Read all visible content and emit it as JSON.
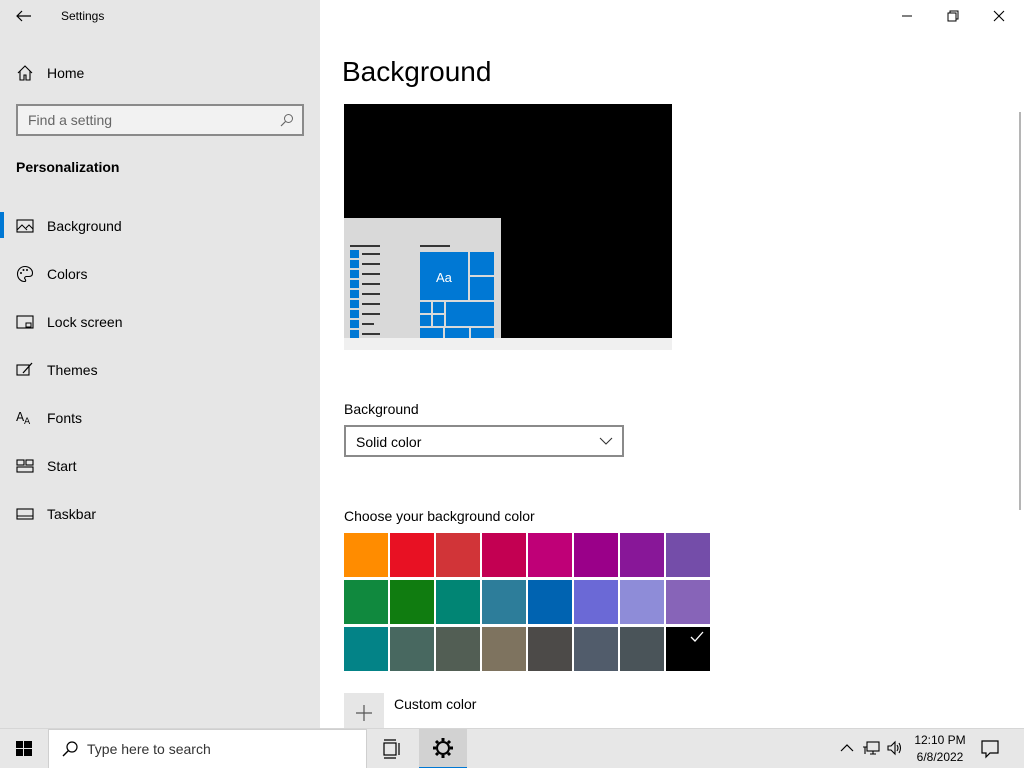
{
  "app": {
    "title": "Settings"
  },
  "sidebar": {
    "home_label": "Home",
    "search_placeholder": "Find a setting",
    "section_title": "Personalization",
    "items": [
      {
        "label": "Background",
        "icon": "picture-icon",
        "active": true
      },
      {
        "label": "Colors",
        "icon": "palette-icon",
        "active": false
      },
      {
        "label": "Lock screen",
        "icon": "lock-screen-icon",
        "active": false
      },
      {
        "label": "Themes",
        "icon": "themes-icon",
        "active": false
      },
      {
        "label": "Fonts",
        "icon": "fonts-icon",
        "active": false
      },
      {
        "label": "Start",
        "icon": "start-icon",
        "active": false
      },
      {
        "label": "Taskbar",
        "icon": "taskbar-icon",
        "active": false
      }
    ]
  },
  "main": {
    "title": "Background",
    "preview_tile_text": "Aa",
    "background_label": "Background",
    "background_value": "Solid color",
    "choose_label": "Choose your background color",
    "custom_color_label": "Custom color",
    "swatches": [
      "#ff8c00",
      "#e81123",
      "#d13438",
      "#c30052",
      "#bf0077",
      "#9a0089",
      "#881798",
      "#744da9",
      "#10893e",
      "#107c10",
      "#018574",
      "#2d7d9a",
      "#0063b1",
      "#6b69d6",
      "#8e8cd8",
      "#8764b8",
      "#038387",
      "#486860",
      "#525e54",
      "#7e735f",
      "#4c4a48",
      "#515c6b",
      "#4a5459",
      "#000000"
    ],
    "selected_swatch_index": 23
  },
  "taskbar": {
    "search_placeholder": "Type here to search",
    "time": "12:10 PM",
    "date": "6/8/2022"
  },
  "colors": {
    "accent": "#0078d4",
    "sidebar_bg": "#e6e6e6"
  }
}
